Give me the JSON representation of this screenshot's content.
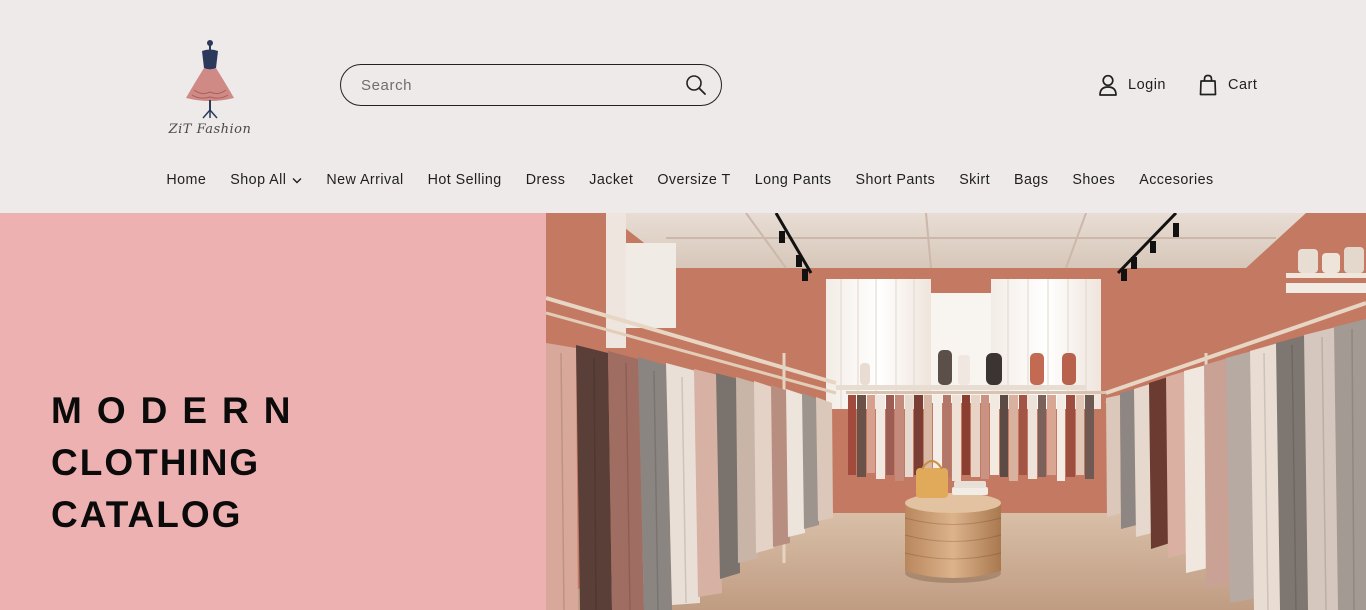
{
  "brand": {
    "name": "ZiT Fashion"
  },
  "search": {
    "placeholder": "Search"
  },
  "account": {
    "login_label": "Login",
    "cart_label": "Cart"
  },
  "nav": {
    "items": [
      "Home",
      "Shop All",
      "New Arrival",
      "Hot Selling",
      "Dress",
      "Jacket",
      "Oversize T",
      "Long Pants",
      "Short Pants",
      "Skirt",
      "Bags",
      "Shoes",
      "Accesories"
    ]
  },
  "hero": {
    "line1": "MODERN",
    "line2": "CLOTHING",
    "line3": "CATALOG"
  },
  "colors": {
    "header_bg": "#efeaea",
    "hero_panel": "#eeb1b1",
    "text": "#1f1f1f"
  },
  "icons": {
    "logo": "dress-mannequin-icon",
    "search": "search-icon",
    "login": "user-icon",
    "cart": "shopping-bag-icon",
    "dropdown": "chevron-down-icon"
  }
}
